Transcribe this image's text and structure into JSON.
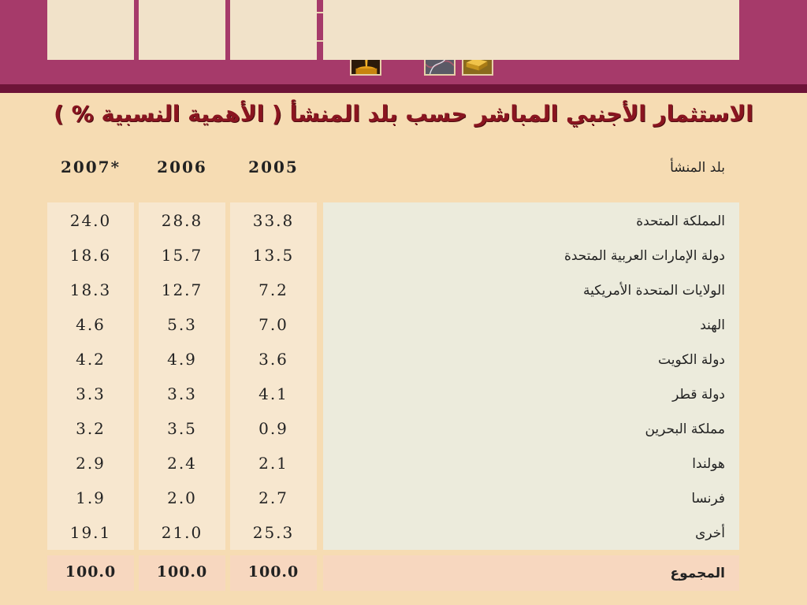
{
  "title": "الاستثمار الأجنبي المباشر حسب بلد المنشأ ( الأهمية النسبية % )",
  "header_images": [
    {
      "name": "empty-frame"
    },
    {
      "name": "industrial-plant-icon"
    },
    {
      "name": "oil-pump-icon"
    },
    {
      "name": "money-bills-icon"
    },
    {
      "name": "empty-frame"
    },
    {
      "name": "oil-pouring-icon"
    },
    {
      "name": "wire-tangle-icon"
    },
    {
      "name": "gold-bars-icon"
    }
  ],
  "table": {
    "header": {
      "label": "بلد المنشأ",
      "y2005": "2005",
      "y2006": "2006",
      "y2007": "2007*"
    },
    "rows": [
      {
        "label": "المملكة المتحدة",
        "y2005": "33.8",
        "y2006": "28.8",
        "y2007": "24.0"
      },
      {
        "label": "دولة الإمارات العربية المتحدة",
        "y2005": "13.5",
        "y2006": "15.7",
        "y2007": "18.6"
      },
      {
        "label": "الولايات المتحدة الأمريكية",
        "y2005": "7.2",
        "y2006": "12.7",
        "y2007": "18.3"
      },
      {
        "label": "الهند",
        "y2005": "7.0",
        "y2006": "5.3",
        "y2007": "4.6"
      },
      {
        "label": "دولة الكويت",
        "y2005": "3.6",
        "y2006": "4.9",
        "y2007": "4.2"
      },
      {
        "label": "دولة قطر",
        "y2005": "4.1",
        "y2006": "3.3",
        "y2007": "3.3"
      },
      {
        "label": "مملكة البحرين",
        "y2005": "0.9",
        "y2006": "3.5",
        "y2007": "3.2"
      },
      {
        "label": "هولندا",
        "y2005": "2.1",
        "y2006": "2.4",
        "y2007": "2.9"
      },
      {
        "label": "فرنسا",
        "y2005": "2.7",
        "y2006": "2.0",
        "y2007": "1.9"
      },
      {
        "label": "أخرى",
        "y2005": "25.3",
        "y2006": "21.0",
        "y2007": "19.1"
      }
    ],
    "total": {
      "label": "المجموع",
      "y2005": "100.0",
      "y2006": "100.0",
      "y2007": "100.0"
    }
  },
  "colors": {
    "banner": "#a63a6a",
    "banner_stripe": "#6e1438",
    "background": "#f6dcb3",
    "title": "#8a1520"
  }
}
